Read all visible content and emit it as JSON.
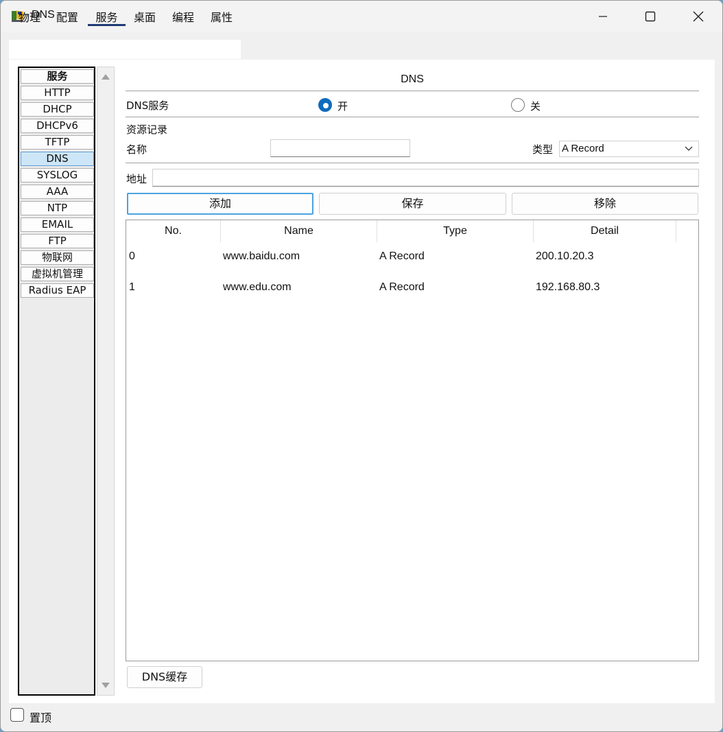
{
  "window": {
    "title": "DNS"
  },
  "tabs": [
    {
      "label": "物理"
    },
    {
      "label": "配置"
    },
    {
      "label": "服务",
      "active": true
    },
    {
      "label": "桌面"
    },
    {
      "label": "编程"
    },
    {
      "label": "属性"
    }
  ],
  "sidebar": {
    "items": [
      {
        "label": "服务"
      },
      {
        "label": "HTTP"
      },
      {
        "label": "DHCP"
      },
      {
        "label": "DHCPv6"
      },
      {
        "label": "TFTP"
      },
      {
        "label": "DNS",
        "selected": true
      },
      {
        "label": "SYSLOG"
      },
      {
        "label": "AAA"
      },
      {
        "label": "NTP"
      },
      {
        "label": "EMAIL"
      },
      {
        "label": "FTP"
      },
      {
        "label": "物联网"
      },
      {
        "label": "虚拟机管理"
      },
      {
        "label": "Radius EAP"
      }
    ]
  },
  "panel": {
    "title": "DNS",
    "service_label": "DNS服务",
    "on_label": "开",
    "off_label": "关",
    "service_on": true,
    "records_label": "资源记录",
    "name_label": "名称",
    "name_value": "",
    "type_label": "类型",
    "type_value": "A Record",
    "address_label": "地址",
    "address_value": "",
    "add_label": "添加",
    "save_label": "保存",
    "remove_label": "移除",
    "cache_label": "DNS缓存"
  },
  "table": {
    "columns": [
      "No.",
      "Name",
      "Type",
      "Detail"
    ],
    "rows": [
      {
        "no": "0",
        "name": "www.baidu.com",
        "type": "A Record",
        "detail": "200.10.20.3"
      },
      {
        "no": "1",
        "name": "www.edu.com",
        "type": "A Record",
        "detail": "192.168.80.3"
      }
    ]
  },
  "footer": {
    "pin_label": "置顶",
    "pin_checked": false
  },
  "colors": {
    "accent": "#0f6cbd",
    "selected_bg": "#cde6f7",
    "focus_border": "#4aa3df"
  }
}
